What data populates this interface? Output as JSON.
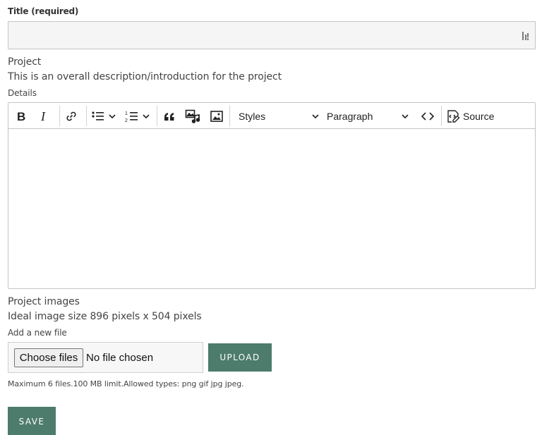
{
  "form": {
    "title_label": "Title (required)",
    "title_value": "",
    "project_label": "Project",
    "project_description": "This is an overall description/introduction for the project",
    "details_label": "Details",
    "images_label": "Project images",
    "images_hint": "Ideal image size 896 pixels x 504 pixels",
    "add_file_label": "Add a new file",
    "choose_files_label": "Choose files",
    "no_file_label": "No file chosen",
    "upload_label": "UPLOAD",
    "file_help": "Maximum 6 files.100 MB limit.Allowed types: png gif jpg jpeg.",
    "save_label": "SAVE"
  },
  "toolbar": {
    "styles_label": "Styles",
    "paragraph_label": "Paragraph",
    "source_label": "Source"
  },
  "colors": {
    "accent": "#4d7b6c",
    "input_bg": "#f5f5f5",
    "border": "#c4c4c4"
  }
}
